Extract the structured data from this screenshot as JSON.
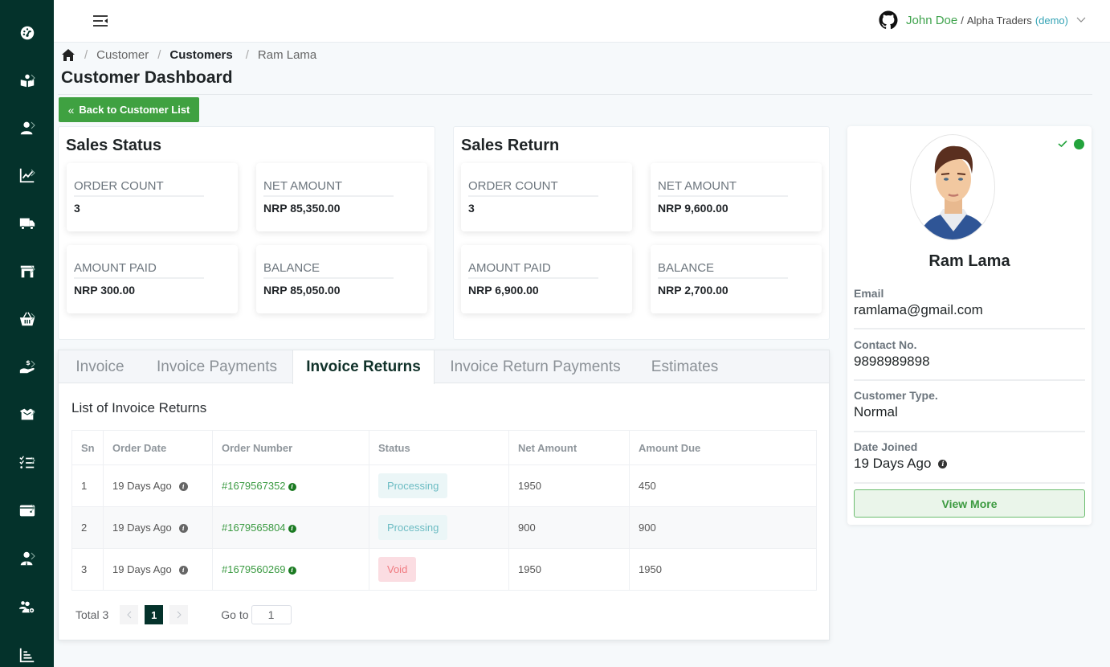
{
  "sidebar": {
    "items": [
      {
        "icon": "dashboard-gauge-icon",
        "has_submenu": false
      },
      {
        "icon": "reader-book-icon",
        "has_submenu": true
      },
      {
        "icon": "user-icon",
        "has_submenu": true
      },
      {
        "icon": "line-chart-icon",
        "has_submenu": true
      },
      {
        "icon": "truck-icon",
        "has_submenu": false
      },
      {
        "icon": "store-icon",
        "has_submenu": true
      },
      {
        "icon": "basket-icon",
        "has_submenu": true
      },
      {
        "icon": "hand-dollar-icon",
        "has_submenu": true
      },
      {
        "icon": "box-open-icon",
        "has_submenu": true
      },
      {
        "icon": "checklist-icon",
        "has_submenu": true
      },
      {
        "icon": "wallet-icon",
        "has_submenu": true
      },
      {
        "icon": "user-tie-icon",
        "has_submenu": true
      },
      {
        "icon": "users-gear-icon",
        "has_submenu": false
      },
      {
        "icon": "bar-chart-icon",
        "has_submenu": false
      }
    ]
  },
  "header": {
    "user_name": "John Doe",
    "separator": "/",
    "company": "Alpha Traders",
    "mode": "(demo)"
  },
  "breadcrumb": {
    "items": [
      "Customer",
      "Customers",
      "Ram Lama"
    ],
    "separator": "/"
  },
  "page": {
    "title": "Customer Dashboard",
    "back_button": "Back to Customer List"
  },
  "sales_status": {
    "title": "Sales Status",
    "stats": [
      {
        "label": "ORDER COUNT",
        "value": "3"
      },
      {
        "label": "NET AMOUNT",
        "value": "NRP 85,350.00"
      },
      {
        "label": "AMOUNT PAID",
        "value": "NRP 300.00"
      },
      {
        "label": "BALANCE",
        "value": "NRP 85,050.00"
      }
    ]
  },
  "sales_return": {
    "title": "Sales Return",
    "stats": [
      {
        "label": "ORDER COUNT",
        "value": "3"
      },
      {
        "label": "NET AMOUNT",
        "value": "NRP 9,600.00"
      },
      {
        "label": "AMOUNT PAID",
        "value": "NRP 6,900.00"
      },
      {
        "label": "BALANCE",
        "value": "NRP 2,700.00"
      }
    ]
  },
  "profile": {
    "name": "Ram Lama",
    "status": "online",
    "verified": true,
    "fields": [
      {
        "label": "Email",
        "value": "ramlama@gmail.com"
      },
      {
        "label": "Contact No.",
        "value": "9898989898"
      },
      {
        "label": "Customer Type.",
        "value": "Normal"
      },
      {
        "label": "Date Joined",
        "value": "19 Days Ago"
      }
    ],
    "view_more": "View More"
  },
  "tabs": {
    "items": [
      "Invoice",
      "Invoice Payments",
      "Invoice Returns",
      "Invoice Return Payments",
      "Estimates"
    ],
    "active": "Invoice Returns"
  },
  "table": {
    "title": "List of Invoice Returns",
    "columns": [
      "Sn",
      "Order Date",
      "Order Number",
      "Status",
      "Net Amount",
      "Amount Due"
    ],
    "rows": [
      {
        "sn": "1",
        "order_date": "19 Days Ago",
        "order_number": "#1679567352",
        "status": "Processing",
        "net_amount": "1950",
        "amount_due": "450"
      },
      {
        "sn": "2",
        "order_date": "19 Days Ago",
        "order_number": "#1679565804",
        "status": "Processing",
        "net_amount": "900",
        "amount_due": "900"
      },
      {
        "sn": "3",
        "order_date": "19 Days Ago",
        "order_number": "#1679560269",
        "status": "Void",
        "net_amount": "1950",
        "amount_due": "1950"
      }
    ]
  },
  "pagination": {
    "total_label": "Total 3",
    "current_page": "1",
    "goto_label": "Go to",
    "goto_value": "1"
  },
  "colors": {
    "sidebar_bg": "#04322b",
    "primary_green": "#3fa141",
    "processing_bg": "#ebf6f7",
    "processing_text": "#6cbcc3",
    "void_bg": "#fbdde2",
    "void_text": "#f07a80",
    "online": "#23a33c"
  }
}
